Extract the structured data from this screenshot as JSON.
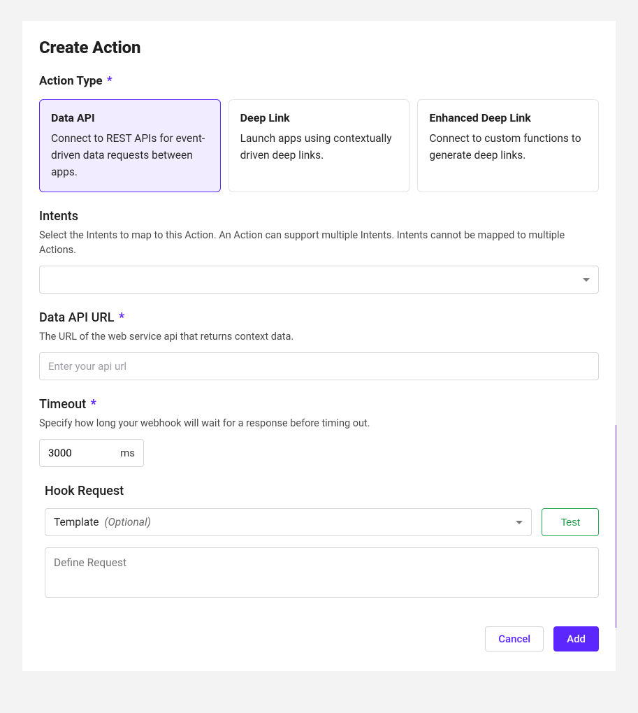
{
  "title": "Create Action",
  "actionType": {
    "label": "Action Type",
    "required": "*",
    "options": [
      {
        "title": "Data API",
        "desc": "Connect to REST APIs for event-driven data requests between apps.",
        "selected": true
      },
      {
        "title": "Deep Link",
        "desc": "Launch apps using contextually driven deep links.",
        "selected": false
      },
      {
        "title": "Enhanced Deep Link",
        "desc": "Connect to custom functions to generate deep links.",
        "selected": false
      }
    ]
  },
  "intents": {
    "label": "Intents",
    "help": "Select the Intents to map to this Action. An Action can support multiple Intents. Intents cannot be mapped to multiple Actions."
  },
  "apiUrl": {
    "label": "Data API URL",
    "required": "*",
    "help": "The URL of the web service api that returns context data.",
    "placeholder": "Enter your api url",
    "value": ""
  },
  "timeout": {
    "label": "Timeout",
    "required": "*",
    "help": "Specify how long your webhook will wait for a response before timing out.",
    "value": "3000",
    "unit": "ms"
  },
  "hook": {
    "label": "Hook Request",
    "templateLabel": "Template",
    "optional": "(Optional)",
    "testLabel": "Test",
    "requestPlaceholder": "Define Request"
  },
  "footer": {
    "cancel": "Cancel",
    "add": "Add"
  }
}
